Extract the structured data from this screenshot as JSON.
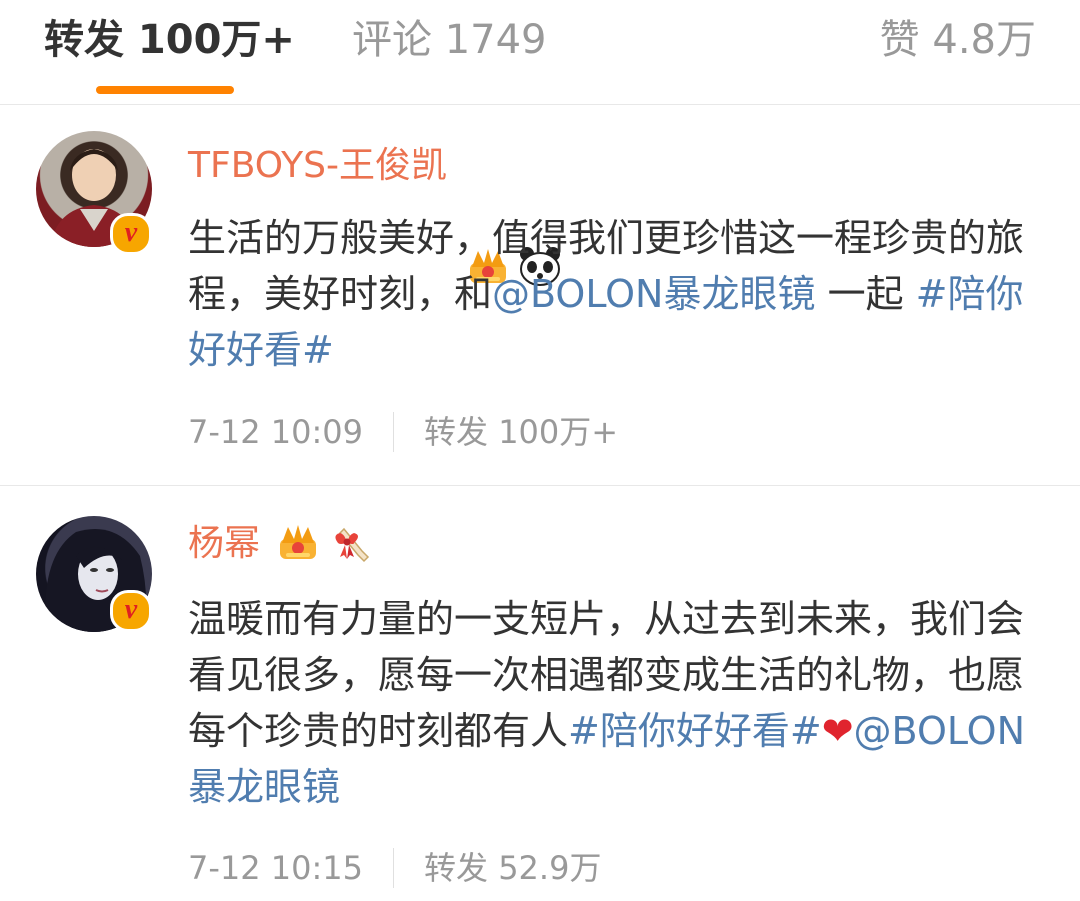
{
  "tabs": {
    "reposts": "转发 100万+",
    "comments": "评论 1749",
    "likes": "赞 4.8万",
    "active_color": "#ff8200"
  },
  "reposts": [
    {
      "username": "TFBOYS-王俊凯",
      "badges": [
        "crown-icon",
        "panda-icon"
      ],
      "verified": "v",
      "content": {
        "text": "生活的万般美好，值得我们更珍惜这一程珍贵的旅程，美好时刻，和",
        "mention": "@BOLON暴龙眼镜",
        "text2": " 一起 ",
        "hashtag": "#陪你好好看#"
      },
      "time": "7-12 10:09",
      "repost_count": "转发 100万+"
    },
    {
      "username": "杨幂",
      "badges": [
        "crown-icon",
        "gift-ribbon-icon"
      ],
      "verified": "v",
      "content": {
        "text": "温暖而有力量的一支短片，从过去到未来，我们会看见很多，愿每一次相遇都变成生活的礼物，也愿每个珍贵的时刻都有人",
        "hashtag": "#陪你好好看#",
        "emoji": "❤",
        "mention": "@BOLON暴龙眼镜"
      },
      "time": "7-12 10:15",
      "repost_count": "转发 52.9万"
    }
  ],
  "colors": {
    "username": "#eb7350",
    "link": "#507daf",
    "text": "#333333",
    "muted": "#999999"
  }
}
